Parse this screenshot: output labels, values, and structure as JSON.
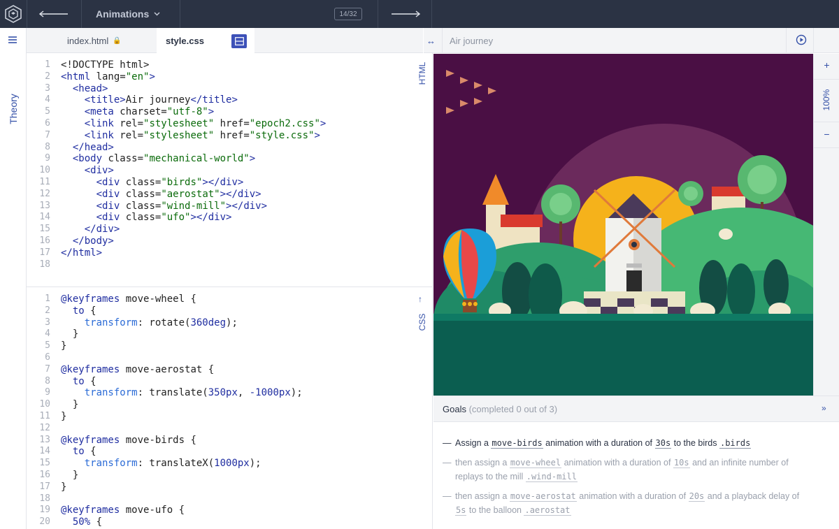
{
  "topbar": {
    "course": "Animations",
    "progress": "14/32"
  },
  "rail": {
    "theory": "Theory"
  },
  "tabs": [
    {
      "label": "index.html",
      "active": false,
      "locked": true
    },
    {
      "label": "style.css",
      "active": true
    }
  ],
  "html_pane": {
    "label": "HTML",
    "line_numbers": [
      "1",
      "2",
      "3",
      "4",
      "5",
      "6",
      "7",
      "8",
      "9",
      "10",
      "11",
      "12",
      "13",
      "14",
      "15",
      "16",
      "17",
      "18"
    ],
    "lines": [
      [
        [
          "plain",
          "<!DOCTYPE html>"
        ]
      ],
      [
        [
          "tag",
          "<html "
        ],
        [
          "attr",
          "lang="
        ],
        [
          "str",
          "\"en\""
        ],
        [
          "tag",
          ">"
        ]
      ],
      [
        [
          "plain",
          "  "
        ],
        [
          "tag",
          "<head>"
        ]
      ],
      [
        [
          "plain",
          "    "
        ],
        [
          "tag",
          "<title>"
        ],
        [
          "plain",
          "Air journey"
        ],
        [
          "tag",
          "</title>"
        ]
      ],
      [
        [
          "plain",
          "    "
        ],
        [
          "tag",
          "<meta "
        ],
        [
          "attr",
          "charset="
        ],
        [
          "str",
          "\"utf-8\""
        ],
        [
          "tag",
          ">"
        ]
      ],
      [
        [
          "plain",
          "    "
        ],
        [
          "tag",
          "<link "
        ],
        [
          "attr",
          "rel="
        ],
        [
          "str",
          "\"stylesheet\""
        ],
        [
          "attr",
          " href="
        ],
        [
          "str",
          "\"epoch2.css\""
        ],
        [
          "tag",
          ">"
        ]
      ],
      [
        [
          "plain",
          "    "
        ],
        [
          "tag",
          "<link "
        ],
        [
          "attr",
          "rel="
        ],
        [
          "str",
          "\"stylesheet\""
        ],
        [
          "attr",
          " href="
        ],
        [
          "str",
          "\"style.css\""
        ],
        [
          "tag",
          ">"
        ]
      ],
      [
        [
          "plain",
          "  "
        ],
        [
          "tag",
          "</head>"
        ]
      ],
      [
        [
          "plain",
          "  "
        ],
        [
          "tag",
          "<body "
        ],
        [
          "attr",
          "class="
        ],
        [
          "str",
          "\"mechanical-world\""
        ],
        [
          "tag",
          ">"
        ]
      ],
      [
        [
          "plain",
          "    "
        ],
        [
          "tag",
          "<div>"
        ]
      ],
      [
        [
          "plain",
          "      "
        ],
        [
          "tag",
          "<div "
        ],
        [
          "attr",
          "class="
        ],
        [
          "str",
          "\"birds\""
        ],
        [
          "tag",
          "></div>"
        ]
      ],
      [
        [
          "plain",
          "      "
        ],
        [
          "tag",
          "<div "
        ],
        [
          "attr",
          "class="
        ],
        [
          "str",
          "\"aerostat\""
        ],
        [
          "tag",
          "></div>"
        ]
      ],
      [
        [
          "plain",
          "      "
        ],
        [
          "tag",
          "<div "
        ],
        [
          "attr",
          "class="
        ],
        [
          "str",
          "\"wind-mill\""
        ],
        [
          "tag",
          "></div>"
        ]
      ],
      [
        [
          "plain",
          "      "
        ],
        [
          "tag",
          "<div "
        ],
        [
          "attr",
          "class="
        ],
        [
          "str",
          "\"ufo\""
        ],
        [
          "tag",
          "></div>"
        ]
      ],
      [
        [
          "plain",
          "    "
        ],
        [
          "tag",
          "</div>"
        ]
      ],
      [
        [
          "plain",
          "  "
        ],
        [
          "tag",
          "</body>"
        ]
      ],
      [
        [
          "tag",
          "</html>"
        ]
      ],
      [
        [
          "plain",
          ""
        ]
      ]
    ]
  },
  "css_pane": {
    "label": "CSS",
    "line_numbers": [
      "1",
      "2",
      "3",
      "4",
      "5",
      "6",
      "7",
      "8",
      "9",
      "10",
      "11",
      "12",
      "13",
      "14",
      "15",
      "16",
      "17",
      "18",
      "19",
      "20"
    ],
    "lines": [
      [
        [
          "kw",
          "@keyframes"
        ],
        [
          "plain",
          " move-wheel {"
        ]
      ],
      [
        [
          "plain",
          "  "
        ],
        [
          "kw",
          "to"
        ],
        [
          "plain",
          " {"
        ]
      ],
      [
        [
          "plain",
          "    "
        ],
        [
          "prop",
          "transform"
        ],
        [
          "plain",
          ": rotate("
        ],
        [
          "num",
          "360deg"
        ],
        [
          "plain",
          ");"
        ]
      ],
      [
        [
          "plain",
          "  }"
        ]
      ],
      [
        [
          "plain",
          "}"
        ]
      ],
      [
        [
          "plain",
          ""
        ]
      ],
      [
        [
          "kw",
          "@keyframes"
        ],
        [
          "plain",
          " move-aerostat {"
        ]
      ],
      [
        [
          "plain",
          "  "
        ],
        [
          "kw",
          "to"
        ],
        [
          "plain",
          " {"
        ]
      ],
      [
        [
          "plain",
          "    "
        ],
        [
          "prop",
          "transform"
        ],
        [
          "plain",
          ": translate("
        ],
        [
          "num",
          "350px"
        ],
        [
          "plain",
          ", "
        ],
        [
          "num",
          "-1000px"
        ],
        [
          "plain",
          ");"
        ]
      ],
      [
        [
          "plain",
          "  }"
        ]
      ],
      [
        [
          "plain",
          "}"
        ]
      ],
      [
        [
          "plain",
          ""
        ]
      ],
      [
        [
          "kw",
          "@keyframes"
        ],
        [
          "plain",
          " move-birds {"
        ]
      ],
      [
        [
          "plain",
          "  "
        ],
        [
          "kw",
          "to"
        ],
        [
          "plain",
          " {"
        ]
      ],
      [
        [
          "plain",
          "    "
        ],
        [
          "prop",
          "transform"
        ],
        [
          "plain",
          ": translateX("
        ],
        [
          "num",
          "1000px"
        ],
        [
          "plain",
          ");"
        ]
      ],
      [
        [
          "plain",
          "  }"
        ]
      ],
      [
        [
          "plain",
          "}"
        ]
      ],
      [
        [
          "plain",
          ""
        ]
      ],
      [
        [
          "kw",
          "@keyframes"
        ],
        [
          "plain",
          " move-ufo {"
        ]
      ],
      [
        [
          "plain",
          "  "
        ],
        [
          "num",
          "50%"
        ],
        [
          "plain",
          " {"
        ]
      ]
    ]
  },
  "preview": {
    "title": "Air journey",
    "zoom": "100%"
  },
  "goals": {
    "title": "Goals",
    "status": "(completed 0 out of 3)",
    "items": [
      [
        [
          "t",
          "Assign a "
        ],
        [
          "c",
          "move-birds"
        ],
        [
          "t",
          " animation with a duration of "
        ],
        [
          "c",
          "30s"
        ],
        [
          "t",
          " to the birds "
        ],
        [
          "c",
          ".birds"
        ]
      ],
      [
        [
          "t",
          "then assign a "
        ],
        [
          "c",
          "move-wheel"
        ],
        [
          "t",
          " animation with a duration of "
        ],
        [
          "c",
          "10s"
        ],
        [
          "t",
          " and an infinite number of replays to the mill "
        ],
        [
          "c",
          ".wind-mill"
        ]
      ],
      [
        [
          "t",
          "then assign a "
        ],
        [
          "c",
          "move-aerostat"
        ],
        [
          "t",
          " animation with a duration of "
        ],
        [
          "c",
          "20s"
        ],
        [
          "t",
          " and a playback delay of "
        ],
        [
          "c",
          "5s"
        ],
        [
          "t",
          " to the balloon "
        ],
        [
          "c",
          ".aerostat"
        ]
      ]
    ]
  },
  "colors": {
    "topbar": "#2b3344",
    "accent": "#3551a8",
    "sky": "#4a0f44",
    "ground": "#0b5e50"
  }
}
